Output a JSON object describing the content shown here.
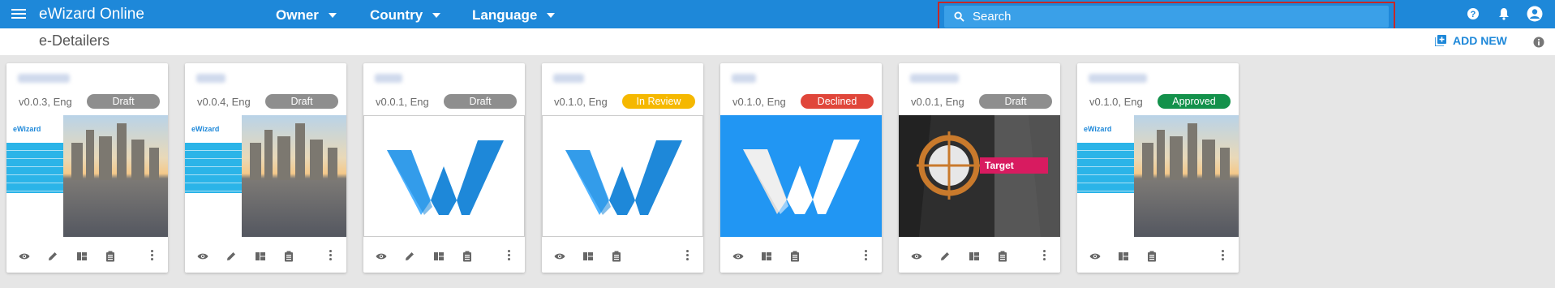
{
  "topbar": {
    "app_title": "eWizard Online",
    "filters": [
      {
        "label": "Owner"
      },
      {
        "label": "Country"
      },
      {
        "label": "Language"
      }
    ],
    "search": {
      "placeholder": "Search"
    },
    "icons": [
      "help-icon",
      "notifications-icon",
      "account-icon"
    ]
  },
  "subheader": {
    "page_title": "e-Detailers",
    "add_new_label": "ADD NEW"
  },
  "colors": {
    "primary": "#1e88d9",
    "draft": "#8e8e8e",
    "in_review": "#f5b800",
    "declined": "#e0463a",
    "approved": "#13914b"
  },
  "cards": [
    {
      "meta": "v0.0.3, Eng",
      "status": "Draft",
      "thumbnail": "city",
      "actions": [
        "view",
        "edit",
        "layout",
        "clipboard"
      ]
    },
    {
      "meta": "v0.0.4, Eng",
      "status": "Draft",
      "thumbnail": "city",
      "actions": [
        "view",
        "edit",
        "layout",
        "clipboard"
      ]
    },
    {
      "meta": "v0.0.1, Eng",
      "status": "Draft",
      "thumbnail": "logo-white",
      "actions": [
        "view",
        "edit",
        "layout",
        "clipboard"
      ]
    },
    {
      "meta": "v0.1.0, Eng",
      "status": "In Review",
      "thumbnail": "logo-white",
      "actions": [
        "view",
        "layout",
        "clipboard"
      ]
    },
    {
      "meta": "v0.1.0, Eng",
      "status": "Declined",
      "thumbnail": "logo-blue",
      "actions": [
        "view",
        "layout",
        "clipboard"
      ]
    },
    {
      "meta": "v0.0.1, Eng",
      "status": "Draft",
      "thumbnail": "target",
      "thumb_text": "Target",
      "actions": [
        "view",
        "edit",
        "layout",
        "clipboard"
      ]
    },
    {
      "meta": "v0.1.0, Eng",
      "status": "Approved",
      "thumbnail": "city",
      "actions": [
        "view",
        "layout",
        "clipboard"
      ]
    }
  ]
}
